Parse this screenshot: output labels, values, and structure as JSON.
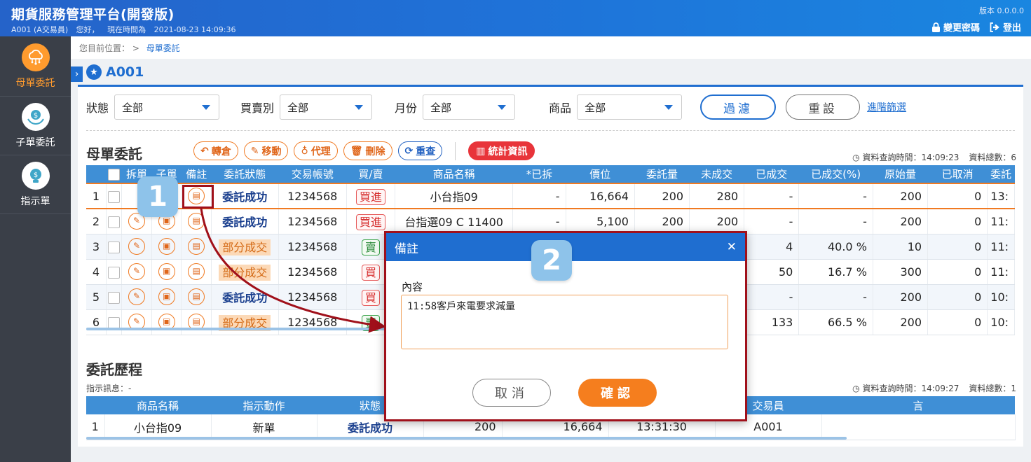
{
  "header": {
    "title": "期貨服務管理平台(開發版)",
    "user": "A001 (A交易員)",
    "greeting": "您好，",
    "time_label": "現在時間為",
    "time_value": "2021-08-23 14:09:36",
    "version": "版本 0.0.0.0",
    "change_password": "變更密碼",
    "logout": "登出"
  },
  "sidebar": {
    "items": [
      {
        "label": "母單委託",
        "icon": "cloud-network-icon",
        "active": true
      },
      {
        "label": "子單委託",
        "icon": "money-hands-icon",
        "active": false
      },
      {
        "label": "指示單",
        "icon": "lightbulb-dollar-icon",
        "active": false
      }
    ]
  },
  "breadcrumb": {
    "prefix": "您目前位置：",
    "sep": ">",
    "current": "母單委託"
  },
  "page": {
    "title": "A001"
  },
  "filters": {
    "status_label": "狀態",
    "status_value": "全部",
    "side_label": "買賣別",
    "side_value": "全部",
    "month_label": "月份",
    "month_value": "全部",
    "product_label": "商品",
    "product_value": "全部",
    "filter_btn": "過濾",
    "reset_btn": "重設",
    "advanced": "進階篩選"
  },
  "mother": {
    "title": "母單委託",
    "actions": {
      "transfer": "轉倉",
      "move": "移動",
      "proxy": "代理",
      "delete": "刪除",
      "recheck": "重查",
      "stats": "統計資訊"
    },
    "query_time": "資料查詢時間：14:09:23",
    "total": "資料總數：6",
    "columns": [
      "",
      "",
      "拆單",
      "子單",
      "備註",
      "委託狀態",
      "交易帳號",
      "買/賣",
      "商品名稱",
      "*已拆",
      "價位",
      "委託量",
      "未成交",
      "已成交",
      "已成交(%)",
      "原始量",
      "已取消",
      "委託"
    ],
    "rows": [
      {
        "no": "1",
        "status": "委託成功",
        "status_type": "ok",
        "account": "1234568",
        "side": "買進",
        "side_type": "buy",
        "product": "小台指09",
        "split": "-",
        "price": "16,664",
        "qty": "200",
        "unfilled": "280",
        "filled": "-",
        "filled_pct": "-",
        "orig": "200",
        "cancel": "0",
        "time": "13:"
      },
      {
        "no": "2",
        "status": "委託成功",
        "status_type": "ok",
        "account": "1234568",
        "side": "買進",
        "side_type": "buy",
        "product": "台指選09 C 11400",
        "split": "-",
        "price": "5,100",
        "qty": "200",
        "unfilled": "200",
        "filled": "-",
        "filled_pct": "-",
        "orig": "200",
        "cancel": "0",
        "time": "11:"
      },
      {
        "no": "3",
        "status": "部分成交",
        "status_type": "part",
        "account": "1234568",
        "side": "賣",
        "side_type": "sell",
        "product": "",
        "split": "",
        "price": "",
        "qty": "",
        "unfilled": "",
        "filled": "4",
        "filled_pct": "40.0 %",
        "orig": "10",
        "cancel": "0",
        "time": "11:"
      },
      {
        "no": "4",
        "status": "部分成交",
        "status_type": "part",
        "account": "1234568",
        "side": "買",
        "side_type": "buy",
        "product": "",
        "split": "",
        "price": "",
        "qty": "",
        "unfilled": "",
        "filled": "50",
        "filled_pct": "16.7 %",
        "orig": "300",
        "cancel": "0",
        "time": "11:"
      },
      {
        "no": "5",
        "status": "委託成功",
        "status_type": "ok",
        "account": "1234568",
        "side": "買",
        "side_type": "buy",
        "product": "",
        "split": "",
        "price": "",
        "qty": "",
        "unfilled": "",
        "filled": "-",
        "filled_pct": "-",
        "orig": "200",
        "cancel": "0",
        "time": "10:"
      },
      {
        "no": "6",
        "status": "部分成交",
        "status_type": "part",
        "account": "1234568",
        "side": "賣",
        "side_type": "sell",
        "product": "",
        "split": "",
        "price": "",
        "qty": "",
        "unfilled": "",
        "filled": "133",
        "filled_pct": "66.5 %",
        "orig": "200",
        "cancel": "0",
        "time": "10:"
      }
    ]
  },
  "history": {
    "title": "委託歷程",
    "info_label": "指示訊息：-",
    "query_time": "資料查詢時間：14:09:27",
    "total": "資料總數：1",
    "columns": [
      "",
      "商品名稱",
      "指示動作",
      "狀態",
      "",
      "",
      "",
      "交易員",
      "言"
    ],
    "rows": [
      {
        "no": "1",
        "product": "小台指09",
        "action": "新單",
        "status": "委託成功",
        "qty": "200",
        "price": "16,664",
        "time": "13:31:30",
        "trader": "A001"
      }
    ]
  },
  "modal": {
    "title": "備註",
    "content_label": "內容",
    "content_value": "11:58客戶來電要求減量",
    "cancel": "取消",
    "confirm": "確認"
  },
  "annotations": {
    "step1": "1",
    "step2": "2"
  },
  "colors": {
    "primary": "#1f6ed0",
    "accent": "#f07a22",
    "highlight": "#a0101a"
  }
}
